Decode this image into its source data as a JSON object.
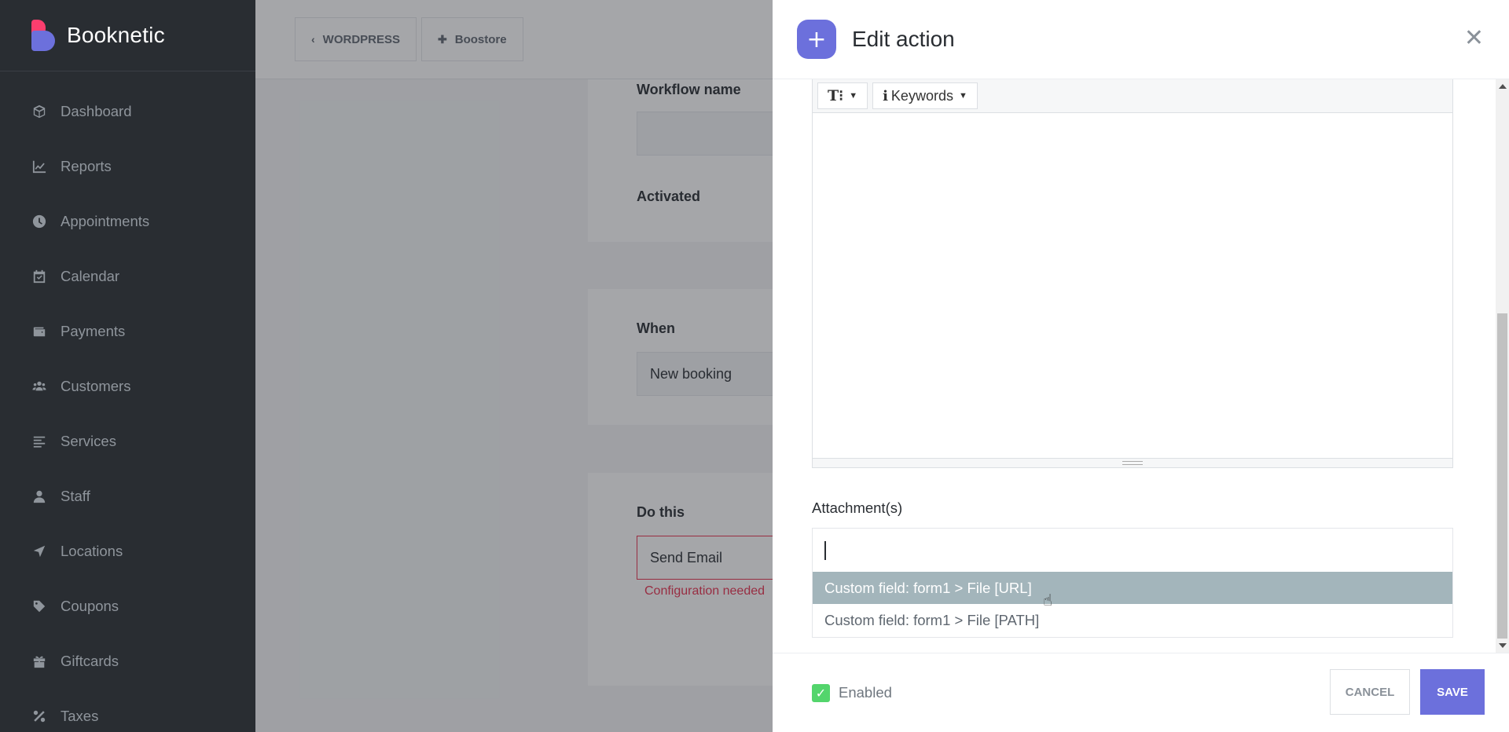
{
  "app": {
    "name": "Booknetic"
  },
  "sidebar": {
    "items": [
      {
        "label": "Dashboard",
        "icon": "cube-icon"
      },
      {
        "label": "Reports",
        "icon": "chart-line-icon"
      },
      {
        "label": "Appointments",
        "icon": "clock-icon"
      },
      {
        "label": "Calendar",
        "icon": "calendar-icon"
      },
      {
        "label": "Payments",
        "icon": "wallet-icon"
      },
      {
        "label": "Customers",
        "icon": "users-icon"
      },
      {
        "label": "Services",
        "icon": "list-icon"
      },
      {
        "label": "Staff",
        "icon": "user-icon"
      },
      {
        "label": "Locations",
        "icon": "location-arrow-icon"
      },
      {
        "label": "Coupons",
        "icon": "tag-icon"
      },
      {
        "label": "Giftcards",
        "icon": "gift-icon"
      },
      {
        "label": "Taxes",
        "icon": "percent-icon"
      }
    ]
  },
  "topbar": {
    "wordpress": "WORDPRESS",
    "boostore": "Boostore"
  },
  "workflow": {
    "name_label": "Workflow name",
    "name_value": "",
    "activated_label": "Activated",
    "activated": true,
    "when_label": "When",
    "when_value": "New booking",
    "do_label": "Do this",
    "do_value": "Send Email",
    "config_error": "Configuration needed"
  },
  "panel": {
    "title": "Edit action",
    "toolbar": {
      "text_format": "T⁝",
      "keywords": "Keywords"
    },
    "attachments_label": "Attachment(s)",
    "attachment_options": [
      {
        "label": "Custom field: form1 > File [URL]",
        "selected": true
      },
      {
        "label": "Custom field: form1 > File [PATH]",
        "selected": false
      }
    ],
    "enabled_label": "Enabled",
    "enabled": true,
    "cancel": "CANCEL",
    "save": "SAVE"
  },
  "colors": {
    "accent": "#6c70dc",
    "sidebar_bg": "#292d32",
    "highlight": "#a3b5bb",
    "check": "#53d56c",
    "error": "#e8304f"
  }
}
